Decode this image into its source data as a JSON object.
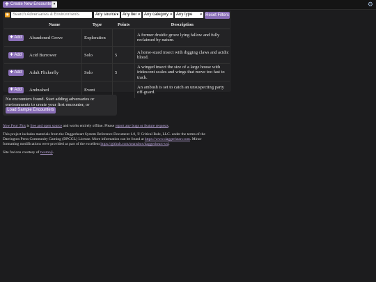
{
  "topbar": {
    "new_encounter_label": "Create New Encounter",
    "encounter_dropdown_arrow": "▾"
  },
  "filters": {
    "search_placeholder": "Search Adversaries & Environments",
    "source": "Any source",
    "tier": "Any tier",
    "category": "Any category",
    "type": "Any type",
    "reset_label": "Reset Filters"
  },
  "table": {
    "headers": [
      "",
      "Name",
      "Type",
      "Points",
      "Description"
    ],
    "rows": [
      {
        "add": "Add",
        "name": "Abandoned Grove",
        "type": "Exploration",
        "points": "",
        "description": "A former druidic grove lying fallow and fully reclaimed by nature."
      },
      {
        "add": "Add",
        "name": "Acid Burrower",
        "type": "Solo",
        "points": "5",
        "description": "A horse-sized insect with digging claws and acidic blood."
      },
      {
        "add": "Add",
        "name": "Adult Flickerfly",
        "type": "Solo",
        "points": "5",
        "description": "A winged insect the size of a large house with iridescent scales and wings that move too fast to track."
      },
      {
        "add": "Add",
        "name": "Ambushed",
        "type": "Event",
        "points": "",
        "description": "An ambush is set to catch an unsuspecting party off-guard."
      }
    ]
  },
  "encounter": {
    "empty_message": "No encounters found. Start adding adversaries or environments to create your first encounter, or",
    "load_sample_label": "Load Sample Encounters"
  },
  "footer": {
    "app_name": "Now Fear This",
    "p1_mid": " is ",
    "free_open_source": "free and open source",
    "p1_mid2": " and works entirely offline. Please ",
    "report_link": "report any bugs or feature requests",
    "p1_end": ".",
    "p2": "This project includes materials from the Daggerheart System Reference Document 1.0, © Critical Role, LLC. under the terms of the Darrington Press Community Gaming (DPCGL) License. More information can be found at ",
    "p2_link1": "https://www.daggerheart.com",
    "p2_mid": ". Minor formatting modifications were provided as part of the excellent ",
    "p2_link2": "https://github.com/seansbox/daggerheart-srd",
    "p2_end": ".",
    "p3_start": "Site favicon courtesy of ",
    "p3_link": "twemoji",
    "p3_end": "."
  },
  "colors": {
    "accent": "#8a6fb8",
    "background": "#1c1c1e",
    "panel": "#232325",
    "link": "#b9a4d8",
    "rss": "#f0a020"
  }
}
